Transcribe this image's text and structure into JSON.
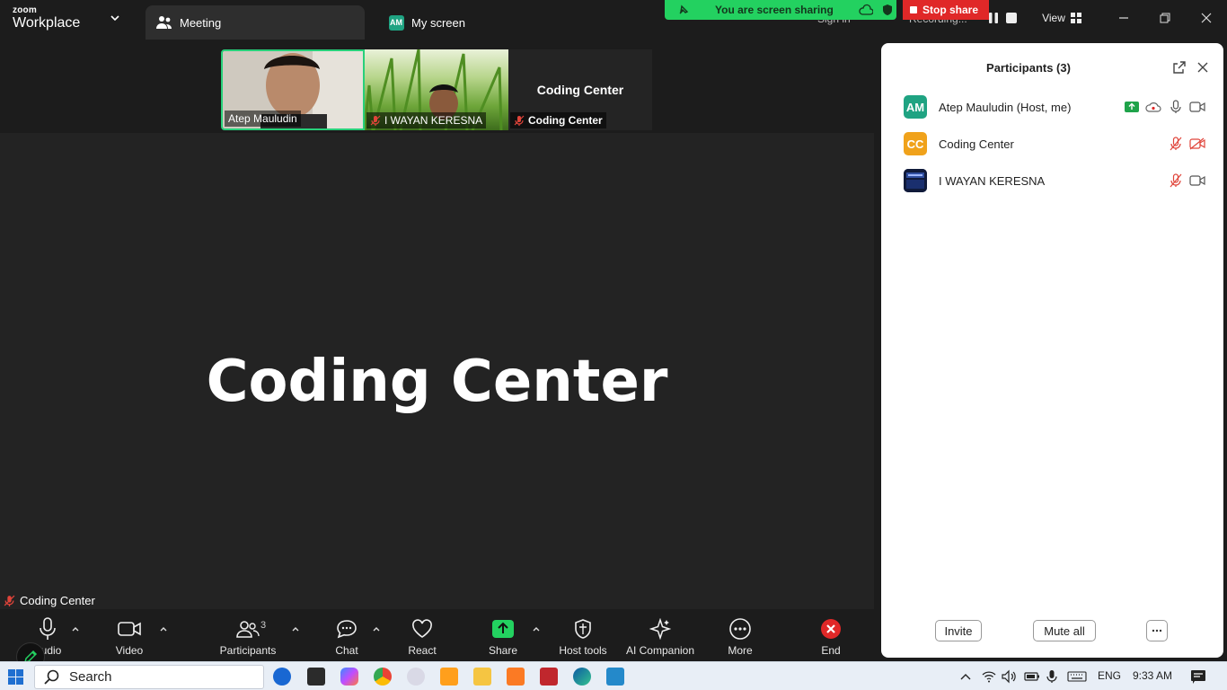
{
  "titlebar": {
    "brand_small": "zoom",
    "brand_big": "Workplace",
    "tab_meeting": "Meeting",
    "tab_myscreen": "My screen",
    "tab_myscreen_avatar": "AM",
    "sharing_banner": "You are screen sharing",
    "stop_share": "Stop share",
    "sign_in": "Sign in",
    "recording": "Recording...",
    "view": "View"
  },
  "video_strip": {
    "tiles": [
      {
        "name": "Atep Mauludin"
      },
      {
        "name": "I WAYAN KERESNA"
      },
      {
        "name": "Coding Center",
        "center_text": "Coding Center"
      }
    ]
  },
  "stage": {
    "name": "Coding Center",
    "label": "Coding Center"
  },
  "toolbar": {
    "audio": "Audio",
    "video": "Video",
    "participants": "Participants",
    "participants_count": "3",
    "chat": "Chat",
    "react": "React",
    "share": "Share",
    "host_tools": "Host tools",
    "ai_companion": "AI Companion",
    "more": "More",
    "end": "End"
  },
  "panel": {
    "title": "Participants (3)",
    "participants": [
      {
        "initials": "AM",
        "name": "Atep Mauludin (Host, me)",
        "color": "#1fa382"
      },
      {
        "initials": "CC",
        "name": "Coding Center",
        "color": "#f0a21b"
      },
      {
        "initials": "",
        "name": "I WAYAN KERESNA",
        "color": "#1b2a55"
      }
    ],
    "invite": "Invite",
    "mute_all": "Mute all",
    "more": "..."
  },
  "taskbar": {
    "search": "Search",
    "lang": "ENG",
    "time": "9:33 AM"
  },
  "colors": {
    "accent_green": "#23d160",
    "stop_red": "#e02828",
    "muted_red": "#e0443a"
  }
}
